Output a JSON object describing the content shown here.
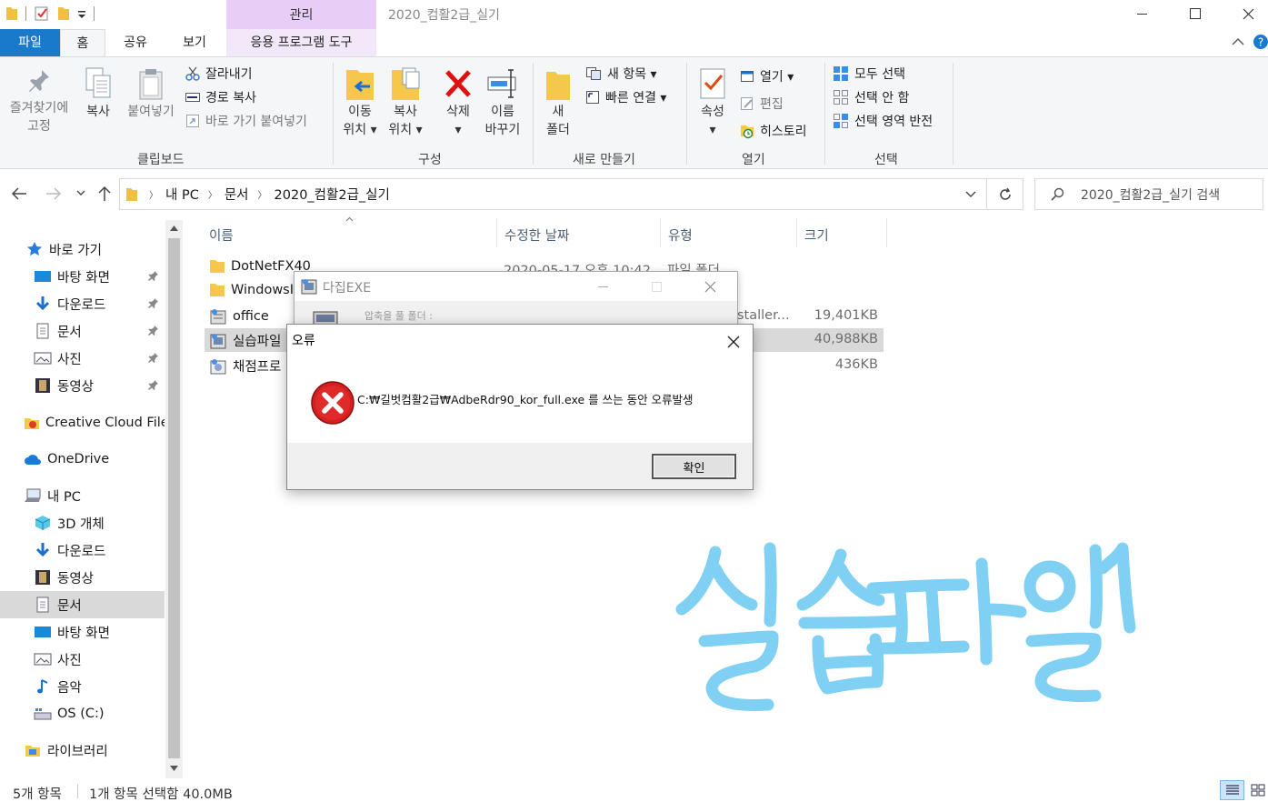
{
  "window": {
    "title": "2020_컴활2급_실기",
    "context_tab": "관리"
  },
  "ribbon_tabs": {
    "file": "파일",
    "home": "홈",
    "share": "공유",
    "view": "보기",
    "app_tools": "응용 프로그램 도구"
  },
  "ribbon": {
    "clipboard": {
      "label": "클립보드",
      "pin_line1": "즐겨찾기에",
      "pin_line2": "고정",
      "copy": "복사",
      "paste": "붙여넣기",
      "cut": "잘라내기",
      "copy_path": "경로 복사",
      "paste_shortcut": "바로 가기 붙여넣기"
    },
    "organize": {
      "label": "구성",
      "move_line1": "이동",
      "move_line2": "위치",
      "copyto_line1": "복사",
      "copyto_line2": "위치",
      "delete": "삭제",
      "rename_line1": "이름",
      "rename_line2": "바꾸기"
    },
    "new": {
      "label": "새로 만들기",
      "folder_line1": "새",
      "folder_line2": "폴더",
      "new_item": "새 항목",
      "easy_access": "빠른 연결"
    },
    "open": {
      "label": "열기",
      "properties": "속성",
      "open": "열기",
      "edit": "편집",
      "history": "히스토리"
    },
    "select": {
      "label": "선택",
      "select_all": "모두 선택",
      "select_none": "선택 안 함",
      "invert": "선택 영역 반전"
    }
  },
  "address": {
    "crumbs": [
      "내 PC",
      "문서",
      "2020_컴활2급_실기"
    ],
    "search_placeholder": "2020_컴활2급_실기 검색"
  },
  "nav": {
    "quick_access": "바로 가기",
    "qa_items": [
      "바탕 화면",
      "다운로드",
      "문서",
      "사진",
      "동영상"
    ],
    "creative_cloud": "Creative Cloud Files",
    "onedrive": "OneDrive",
    "this_pc": "내 PC",
    "pc_items": [
      "3D 개체",
      "다운로드",
      "동영상",
      "문서",
      "바탕 화면",
      "사진",
      "음악",
      "OS (C:)"
    ],
    "libraries": "라이브러리"
  },
  "columns": {
    "name": "이름",
    "date": "수정한 날짜",
    "type": "유형",
    "size": "크기"
  },
  "files": [
    {
      "name": "DotNetFX40",
      "date": "2020-05-17 오후 10:42",
      "type": "파일 폴더",
      "size": ""
    },
    {
      "name": "WindowsI",
      "date": "",
      "type": "",
      "size": ""
    },
    {
      "name": "office",
      "date": "",
      "type": "staller...",
      "size": "19,401KB"
    },
    {
      "name": "실습파일",
      "date": "",
      "type": "",
      "size": "40,988KB"
    },
    {
      "name": "채점프로",
      "date": "",
      "type": "",
      "size": "436KB"
    }
  ],
  "status": {
    "count": "5개 항목",
    "selection": "1개 항목 선택함 40.0MB"
  },
  "dajip": {
    "title": "다집EXE",
    "label": "압축을 풀 폴더 :"
  },
  "error": {
    "title": "오류",
    "message": "C:₩길벗컴활2급₩AdbeRdr90_kor_full.exe 를 쓰는 동안 오류발생",
    "ok": "확인"
  },
  "colors": {
    "file_tab": "#1979ca",
    "manage_tab": "#e8cdf7",
    "handwriting": "#7fd0f2",
    "error_icon": "#d42020"
  }
}
